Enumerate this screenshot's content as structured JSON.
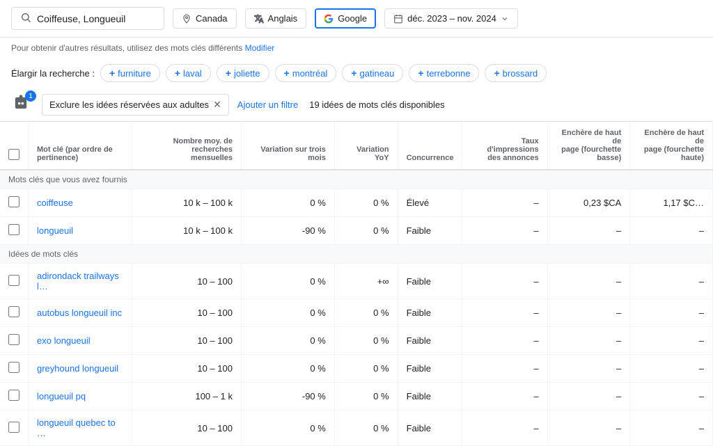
{
  "topbar": {
    "search_value": "Coiffeuse, Longueuil",
    "search_placeholder": "Coiffeuse, Longueuil",
    "country_label": "Canada",
    "language_label": "Anglais",
    "engine_label": "Google",
    "date_label": "déc. 2023 – nov. 2024"
  },
  "info": {
    "text": "Pour obtenir d'autres résultats, utilisez des mots clés différents",
    "link": "Modifier"
  },
  "expand": {
    "label": "Élargir la recherche :",
    "chips": [
      "furniture",
      "laval",
      "joliette",
      "montréal",
      "gatineau",
      "terrebonne",
      "brossard"
    ]
  },
  "filter_row": {
    "badge_count": "1",
    "exclusion_label": "Exclure les idées réservées aux adultes",
    "add_filter_label": "Ajouter un filtre",
    "count_text": "19 idées de mots clés disponibles"
  },
  "table": {
    "headers": [
      "",
      "Mot clé (par ordre de pertinence)",
      "Nombre moy. de recherches mensuelles",
      "Variation sur trois mois",
      "Variation YoY",
      "Concurrence",
      "Taux d'impressions des annonces",
      "Enchère de haut de page (fourchette basse)",
      "Enchère de haut de page (fourchette haute)"
    ],
    "section_provided": "Mots clés que vous avez fournis",
    "section_ideas": "Idées de mots clés",
    "provided_rows": [
      {
        "keyword": "coiffeuse",
        "searches": "10 k – 100 k",
        "variation3m": "0 %",
        "variationYoy": "0 %",
        "competition": "Élevé",
        "impressions": "–",
        "bid_low": "0,23 $CA",
        "bid_high": "1,17 $C…"
      },
      {
        "keyword": "longueuil",
        "searches": "10 k – 100 k",
        "variation3m": "-90 %",
        "variationYoy": "0 %",
        "competition": "Faible",
        "impressions": "–",
        "bid_low": "–",
        "bid_high": "–"
      }
    ],
    "idea_rows": [
      {
        "keyword": "adirondack trailways l…",
        "searches": "10 – 100",
        "variation3m": "0 %",
        "variationYoy": "+∞",
        "competition": "Faible",
        "impressions": "–",
        "bid_low": "–",
        "bid_high": "–"
      },
      {
        "keyword": "autobus longueuil inc",
        "searches": "10 – 100",
        "variation3m": "0 %",
        "variationYoy": "0 %",
        "competition": "Faible",
        "impressions": "–",
        "bid_low": "–",
        "bid_high": "–"
      },
      {
        "keyword": "exo longueuil",
        "searches": "10 – 100",
        "variation3m": "0 %",
        "variationYoy": "0 %",
        "competition": "Faible",
        "impressions": "–",
        "bid_low": "–",
        "bid_high": "–"
      },
      {
        "keyword": "greyhound longueuil",
        "searches": "10 – 100",
        "variation3m": "0 %",
        "variationYoy": "0 %",
        "competition": "Faible",
        "impressions": "–",
        "bid_low": "–",
        "bid_high": "–"
      },
      {
        "keyword": "longueuil pq",
        "searches": "100 – 1 k",
        "variation3m": "-90 %",
        "variationYoy": "0 %",
        "competition": "Faible",
        "impressions": "–",
        "bid_low": "–",
        "bid_high": "–"
      },
      {
        "keyword": "longueuil quebec to …",
        "searches": "10 – 100",
        "variation3m": "0 %",
        "variationYoy": "0 %",
        "competition": "Faible",
        "impressions": "–",
        "bid_low": "–",
        "bid_high": "–"
      }
    ]
  }
}
